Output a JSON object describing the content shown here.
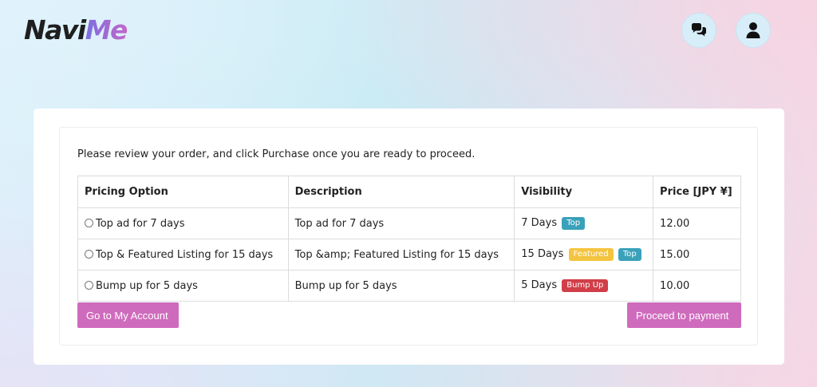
{
  "header": {
    "logo_part1": "Navi",
    "logo_part2": "Me",
    "icons": {
      "chat": "chat-bubbles-icon",
      "user": "user-icon"
    }
  },
  "order": {
    "intro": "Please review your order, and click Purchase once you are ready to proceed.",
    "columns": [
      "Pricing Option",
      "Description",
      "Visibility",
      "Price [JPY ¥]"
    ],
    "rows": [
      {
        "option": "Top ad for 7 days",
        "description": "Top ad for 7 days",
        "days": "7 Days",
        "badges": [
          "Top"
        ],
        "price": "12.00"
      },
      {
        "option": "Top & Featured Listing for 15 days",
        "description": "Top &amp; Featured Listing for 15 days",
        "days": "15 Days",
        "badges": [
          "Featured",
          "Top"
        ],
        "price": "15.00"
      },
      {
        "option": "Bump up for 5 days",
        "description": "Bump up for 5 days",
        "days": "5 Days",
        "badges": [
          "Bump Up"
        ],
        "price": "10.00"
      }
    ]
  },
  "buttons": {
    "account": "Go to My Account",
    "proceed": "Proceed to payment"
  },
  "colors": {
    "accent": "#cf6bbd",
    "badge_top": "#3aa1ba",
    "badge_featured": "#f4c43f",
    "badge_bump": "#d13e48"
  }
}
